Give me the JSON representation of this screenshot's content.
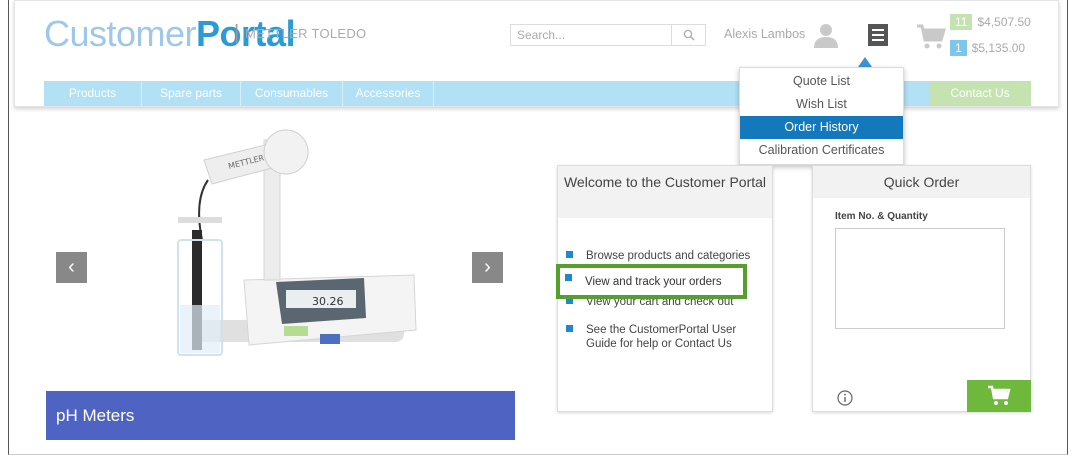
{
  "header": {
    "logo_light": "Customer",
    "logo_bold": "Portal",
    "logo_separator": "|",
    "company": "METTLER TOLEDO",
    "search_placeholder": "Search...",
    "user_name": "Alexis Lambos",
    "badges": [
      {
        "count": "11",
        "amount": "$4,507.50",
        "color": "#c4e3b0"
      },
      {
        "count": "1",
        "amount": "$5,135.00",
        "color": "#7cc6ea"
      }
    ]
  },
  "nav": {
    "items": [
      {
        "label": "Products"
      },
      {
        "label": "Spare parts"
      },
      {
        "label": "Consumables"
      },
      {
        "label": "Accessories"
      }
    ],
    "contact": "Contact Us"
  },
  "dropdown": {
    "items": [
      {
        "label": "Quote List"
      },
      {
        "label": "Wish List"
      },
      {
        "label": "Order History"
      },
      {
        "label": "Calibration Certificates"
      }
    ]
  },
  "carousel": {
    "title": "pH Meters",
    "device_brand": "METTLER TOLEDO",
    "display_value": "30.26"
  },
  "welcome": {
    "title": "Welcome to the Customer Portal",
    "items": [
      "Browse products and categories",
      "View and track your orders",
      "View your cart and check out",
      "See the CustomerPortal User Guide for help or Contact Us"
    ]
  },
  "quick_order": {
    "title": "Quick Order",
    "field_label": "Item No. & Quantity"
  },
  "colors": {
    "accent_blue": "#1478bc",
    "highlight_green": "#55a02a",
    "slide_bar": "#4e63c2"
  }
}
